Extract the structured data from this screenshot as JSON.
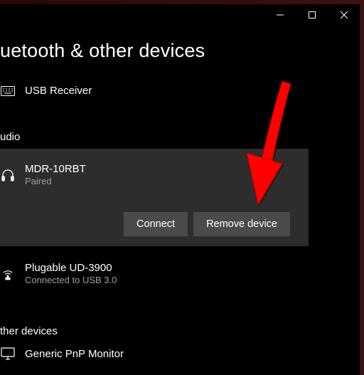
{
  "page_title": "uetooth & other devices",
  "usb_receiver": {
    "name": "USB Receiver"
  },
  "section_audio": "udio",
  "headphones": {
    "name": "MDR-10RBT",
    "status": "Paired",
    "connect_label": "Connect",
    "remove_label": "Remove device"
  },
  "dongle": {
    "name": "Plugable UD-3900",
    "status": "Connected to USB 3.0"
  },
  "section_other": "ther devices",
  "monitor": {
    "name": "Generic PnP Monitor"
  }
}
